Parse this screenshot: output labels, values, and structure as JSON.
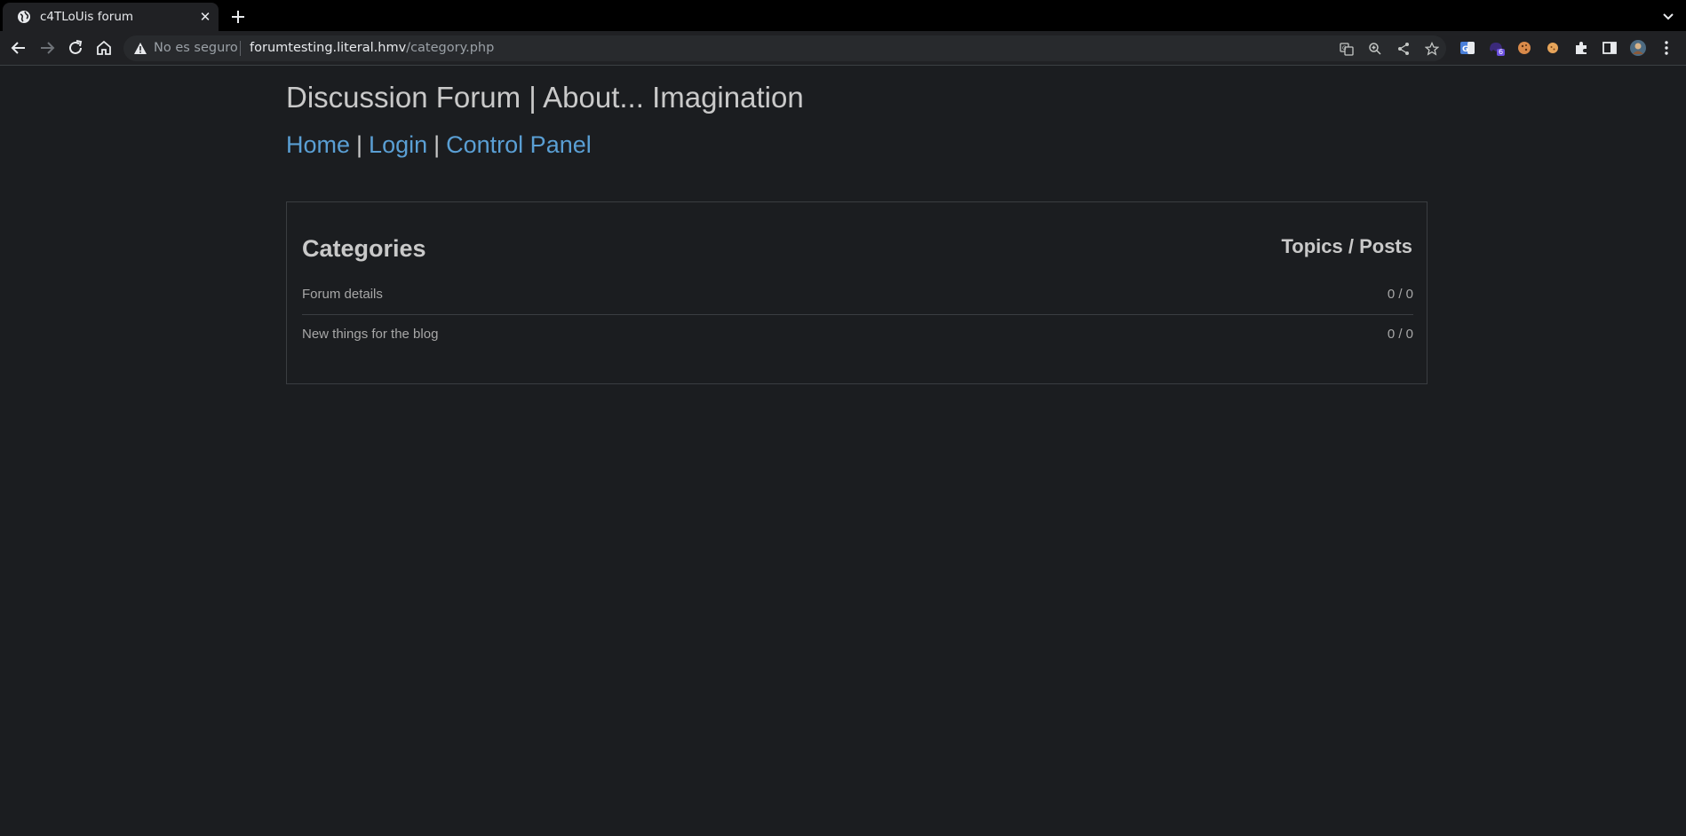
{
  "browser": {
    "tab_title": "c4TLoUis forum",
    "security_label": "No es seguro",
    "url_host": "forumtesting.literal.hmv",
    "url_path": "/category.php",
    "extension_badge": "6"
  },
  "page": {
    "site_title": "Discussion Forum | About... Imagination",
    "nav": {
      "home": "Home",
      "login": "Login",
      "control_panel": "Control Panel",
      "separator": "|"
    },
    "categories_heading": "Categories",
    "counts_heading": "Topics / Posts",
    "categories": [
      {
        "name": "Forum details",
        "counts": "0 / 0"
      },
      {
        "name": "New things for the blog",
        "counts": "0 / 0"
      }
    ]
  },
  "colors": {
    "page_background": "#1b1d20",
    "link": "#5a9fd4",
    "text": "#c9c9c9"
  }
}
